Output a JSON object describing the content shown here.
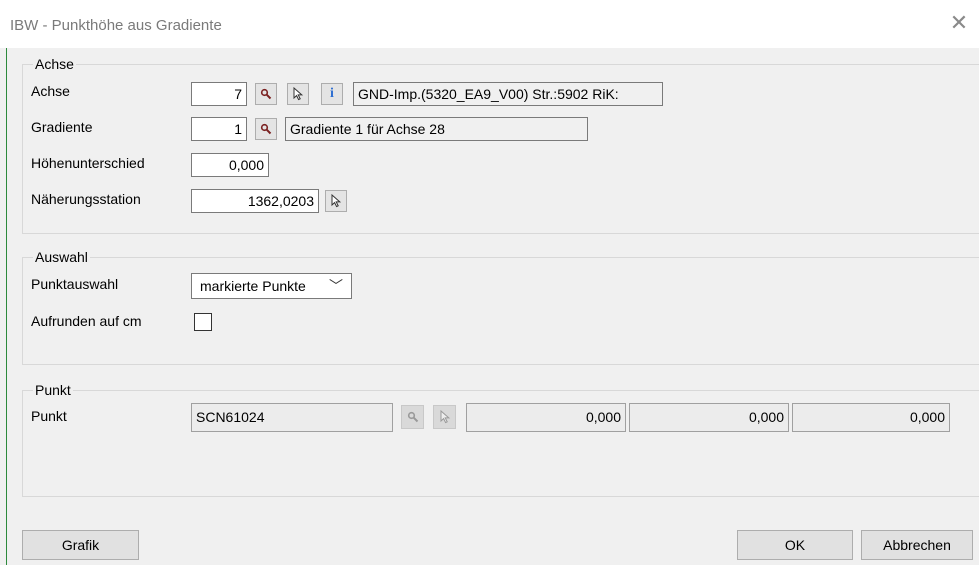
{
  "window": {
    "title": "IBW - Punkthöhe aus Gradiente",
    "close_glyph": "✕"
  },
  "achse_group": {
    "legend": "Achse",
    "achse_label": "Achse",
    "achse_value": "7",
    "achse_description": "GND-Imp.(5320_EA9_V00) Str.:5902 RiK:",
    "gradiente_label": "Gradiente",
    "gradiente_value": "1",
    "gradiente_description": "Gradiente  1 für Achse    28",
    "hoehe_label": "Höhenunterschied",
    "hoehe_value": "0,000",
    "station_label": "Näherungsstation",
    "station_value": "1362,0203",
    "info_glyph": "i"
  },
  "auswahl_group": {
    "legend": "Auswahl",
    "punktauswahl_label": "Punktauswahl",
    "punktauswahl_value": "markierte Punkte",
    "aufrunden_label": "Aufrunden auf cm",
    "aufrunden_checked": false
  },
  "punkt_group": {
    "legend": "Punkt",
    "punkt_label": "Punkt",
    "punkt_value": "SCN61024",
    "x_value": "0,000",
    "y_value": "0,000",
    "z_value": "0,000"
  },
  "buttons": {
    "grafik": "Grafik",
    "ok": "OK",
    "abbrechen": "Abbrechen"
  },
  "colors": {
    "window_bg": "#f0f0f0",
    "title_text": "#7a7a7a",
    "info_icon": "#2f6fd1",
    "window_edge": "#2d8a3c"
  }
}
